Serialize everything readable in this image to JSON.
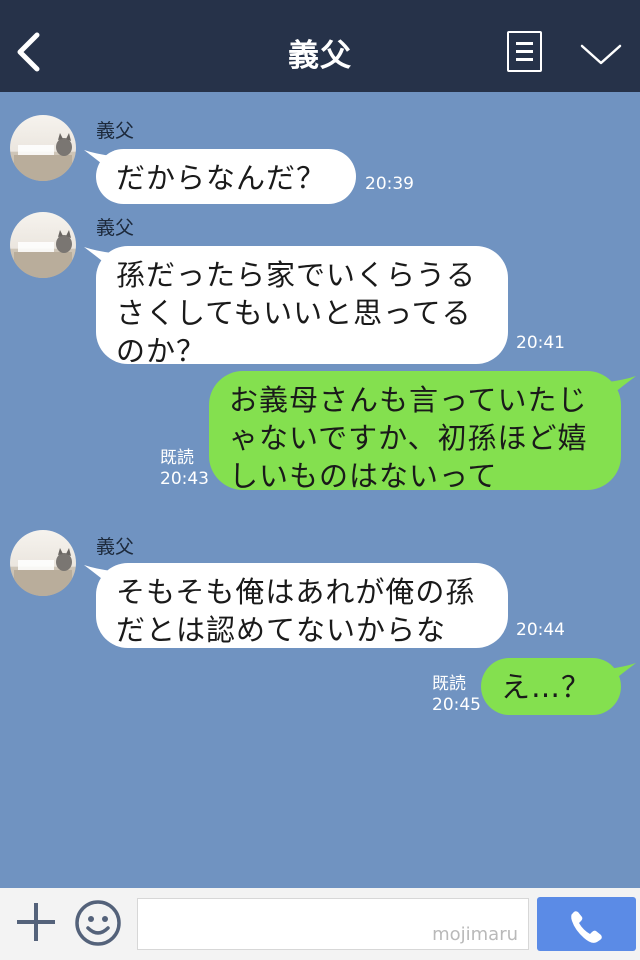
{
  "header": {
    "title": "義父",
    "back_icon": "chevron-left-icon",
    "menu_icon": "menu-list-icon",
    "collapse_icon": "chevron-down-icon"
  },
  "messages": [
    {
      "side": "in",
      "sender": "義父",
      "lines": [
        "だからなんだ？"
      ],
      "time": "20:39"
    },
    {
      "side": "in",
      "sender": "義父",
      "lines": [
        "孫だったら家でいくらうる",
        "さくしてもいいと思ってる",
        "のか？"
      ],
      "time": "20:41"
    },
    {
      "side": "out",
      "read": "既読",
      "lines": [
        "お義母さんも言っていたじ",
        "ゃないですか、初孫ほど嬉",
        "しいものはないって"
      ],
      "time": "20:43"
    },
    {
      "side": "in",
      "sender": "義父",
      "lines": [
        "そもそも俺はあれが俺の孫",
        "だとは認めてないからな"
      ],
      "time": "20:44"
    },
    {
      "side": "out",
      "read": "既読",
      "lines": [
        "え…？"
      ],
      "time": "20:45"
    }
  ],
  "footer": {
    "watermark": "mojimaru",
    "plus_icon": "plus-icon",
    "emoji_icon": "smiley-icon",
    "call_icon": "phone-icon"
  },
  "colors": {
    "background": "#7093c1",
    "header": "#263249",
    "incoming_bubble": "#ffffff",
    "outgoing_bubble": "#84e04f",
    "call_button": "#5b8be6"
  }
}
